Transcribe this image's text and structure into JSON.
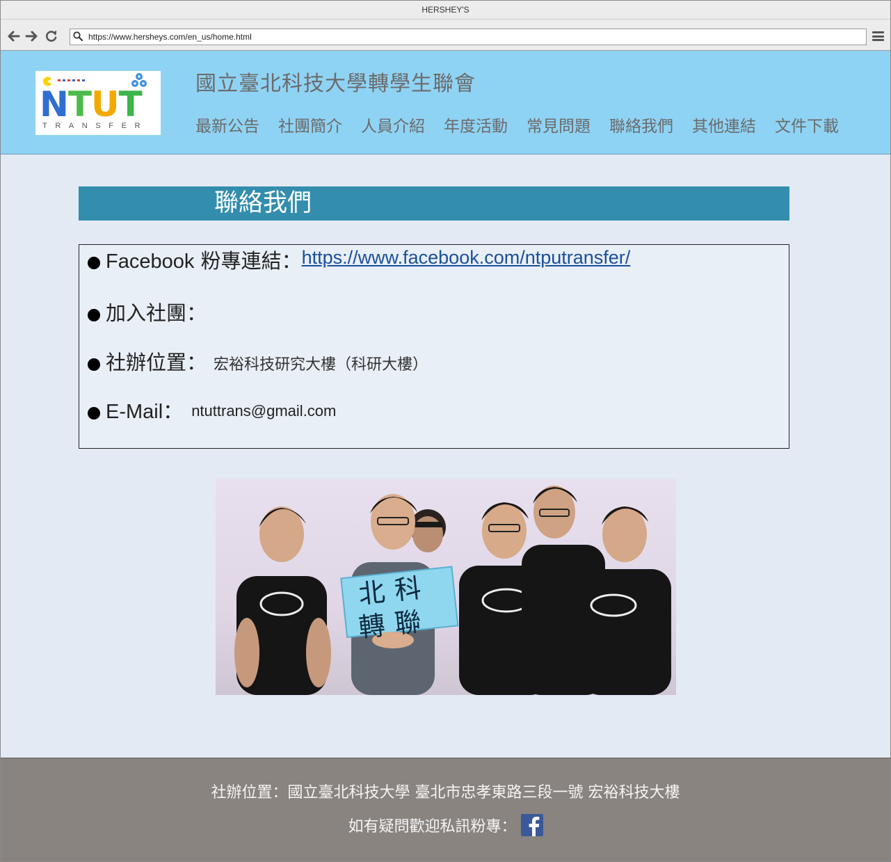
{
  "browser": {
    "window_title": "HERSHEY'S",
    "url": "https://www.hersheys.com/en_us/home.html",
    "back_icon": "arrow-left-icon",
    "forward_icon": "arrow-right-icon",
    "reload_icon": "reload-icon",
    "menu_icon": "hamburger-menu-icon"
  },
  "header": {
    "logo_text": "NTUT",
    "logo_subtext": "TRANSFER",
    "site_title": "國立臺北科技大學轉學生聯會",
    "nav": [
      {
        "label": "最新公告"
      },
      {
        "label": "社團簡介"
      },
      {
        "label": "人員介紹"
      },
      {
        "label": "年度活動"
      },
      {
        "label": "常見問題"
      },
      {
        "label": "聯絡我們"
      },
      {
        "label": "其他連結"
      },
      {
        "label": "文件下載"
      }
    ],
    "background_color": "#8fd3f4"
  },
  "main": {
    "section_title": "聯絡我們",
    "contacts": {
      "facebook": {
        "label_prefix": "Facebook",
        "label_suffix": " 粉專連結：",
        "link": "https://www.facebook.com/ntputransfer/"
      },
      "join": {
        "label": "加入社團："
      },
      "office": {
        "label": "社辦位置：",
        "value": "宏裕科技研究大樓（科研大樓）"
      },
      "email": {
        "label_prefix": "E-Mail",
        "label_suffix": "：",
        "value": "ntuttrans@gmail.com"
      }
    },
    "photo_sign": {
      "line1": "北科",
      "line2": "轉聯"
    },
    "accent_color": "#338dad"
  },
  "footer": {
    "address": "社辦位置：國立臺北科技大學  臺北市忠孝東路三段一號  宏裕科技大樓",
    "message": "如有疑問歡迎私訊粉專：",
    "facebook_icon": "facebook-icon",
    "background_color": "#898480"
  }
}
